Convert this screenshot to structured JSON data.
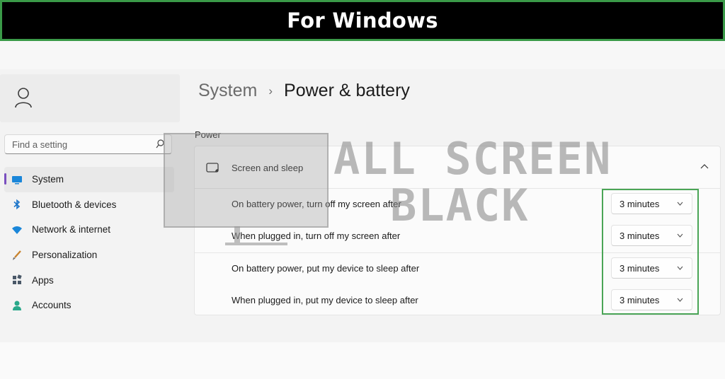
{
  "banner": {
    "title": "For Windows"
  },
  "sidebar": {
    "search_placeholder": "Find a setting",
    "items": [
      {
        "label": "System",
        "icon": "monitor-icon",
        "active": true
      },
      {
        "label": "Bluetooth & devices",
        "icon": "bluetooth-icon"
      },
      {
        "label": "Network & internet",
        "icon": "wifi-icon"
      },
      {
        "label": "Personalization",
        "icon": "paintbrush-icon"
      },
      {
        "label": "Apps",
        "icon": "apps-grid-icon"
      },
      {
        "label": "Accounts",
        "icon": "person-icon"
      }
    ]
  },
  "breadcrumb": {
    "parent": "System",
    "separator": "›",
    "current": "Power & battery"
  },
  "power": {
    "section_title": "Power",
    "screen_sleep": {
      "label": "Screen and sleep",
      "rows": [
        {
          "label": "On battery power, turn off my screen after",
          "value": "3 minutes"
        },
        {
          "label": "When plugged in, turn off my screen after",
          "value": "3 minutes"
        },
        {
          "label": "On battery power, put my device to sleep after",
          "value": "3 minutes"
        },
        {
          "label": "When plugged in, put my device to sleep after",
          "value": "3 minutes"
        }
      ]
    }
  },
  "watermark": {
    "line1": "ALL SCREEN",
    "line2": "BLACK"
  },
  "colors": {
    "highlight": "#4aa556",
    "accent": "#7a4fbf",
    "banner_bg": "#000000"
  }
}
